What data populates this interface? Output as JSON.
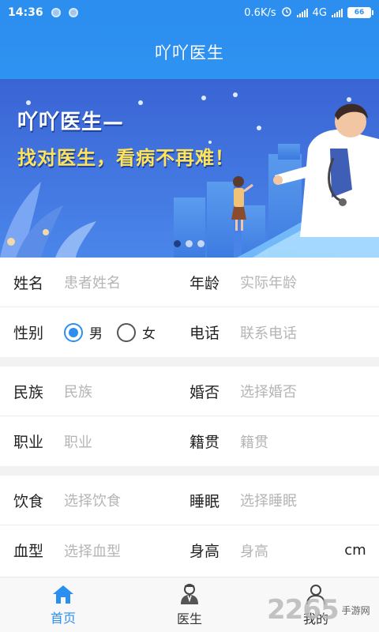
{
  "status_bar": {
    "time": "14:36",
    "speed": "0.6K/s",
    "network": "4G",
    "battery": "66"
  },
  "header": {
    "title": "吖吖医生"
  },
  "banner": {
    "line1": "吖吖医生—",
    "line2": "找对医生，看病不再难！",
    "active_page": 1,
    "page_count": 3
  },
  "form": {
    "name_label": "姓名",
    "name_placeholder": "患者姓名",
    "age_label": "年龄",
    "age_placeholder": "实际年龄",
    "gender_label": "性别",
    "gender_male": "男",
    "gender_female": "女",
    "gender_selected": "男",
    "phone_label": "电话",
    "phone_placeholder": "联系电话",
    "ethnicity_label": "民族",
    "ethnicity_placeholder": "民族",
    "marriage_label": "婚否",
    "marriage_placeholder": "选择婚否",
    "job_label": "职业",
    "job_placeholder": "职业",
    "hometown_label": "籍贯",
    "hometown_placeholder": "籍贯",
    "diet_label": "饮食",
    "diet_placeholder": "选择饮食",
    "sleep_label": "睡眠",
    "sleep_placeholder": "选择睡眠",
    "blood_label": "血型",
    "blood_placeholder": "选择血型",
    "height_label": "身高",
    "height_placeholder": "身高",
    "height_unit": "cm"
  },
  "tabbar": {
    "home": "首页",
    "doctor": "医生",
    "mine": "我的"
  },
  "watermark": {
    "big": "2265",
    "small": "手游网"
  },
  "colors": {
    "primary": "#2c8fef",
    "banner_bg": "#3a6ad8"
  }
}
